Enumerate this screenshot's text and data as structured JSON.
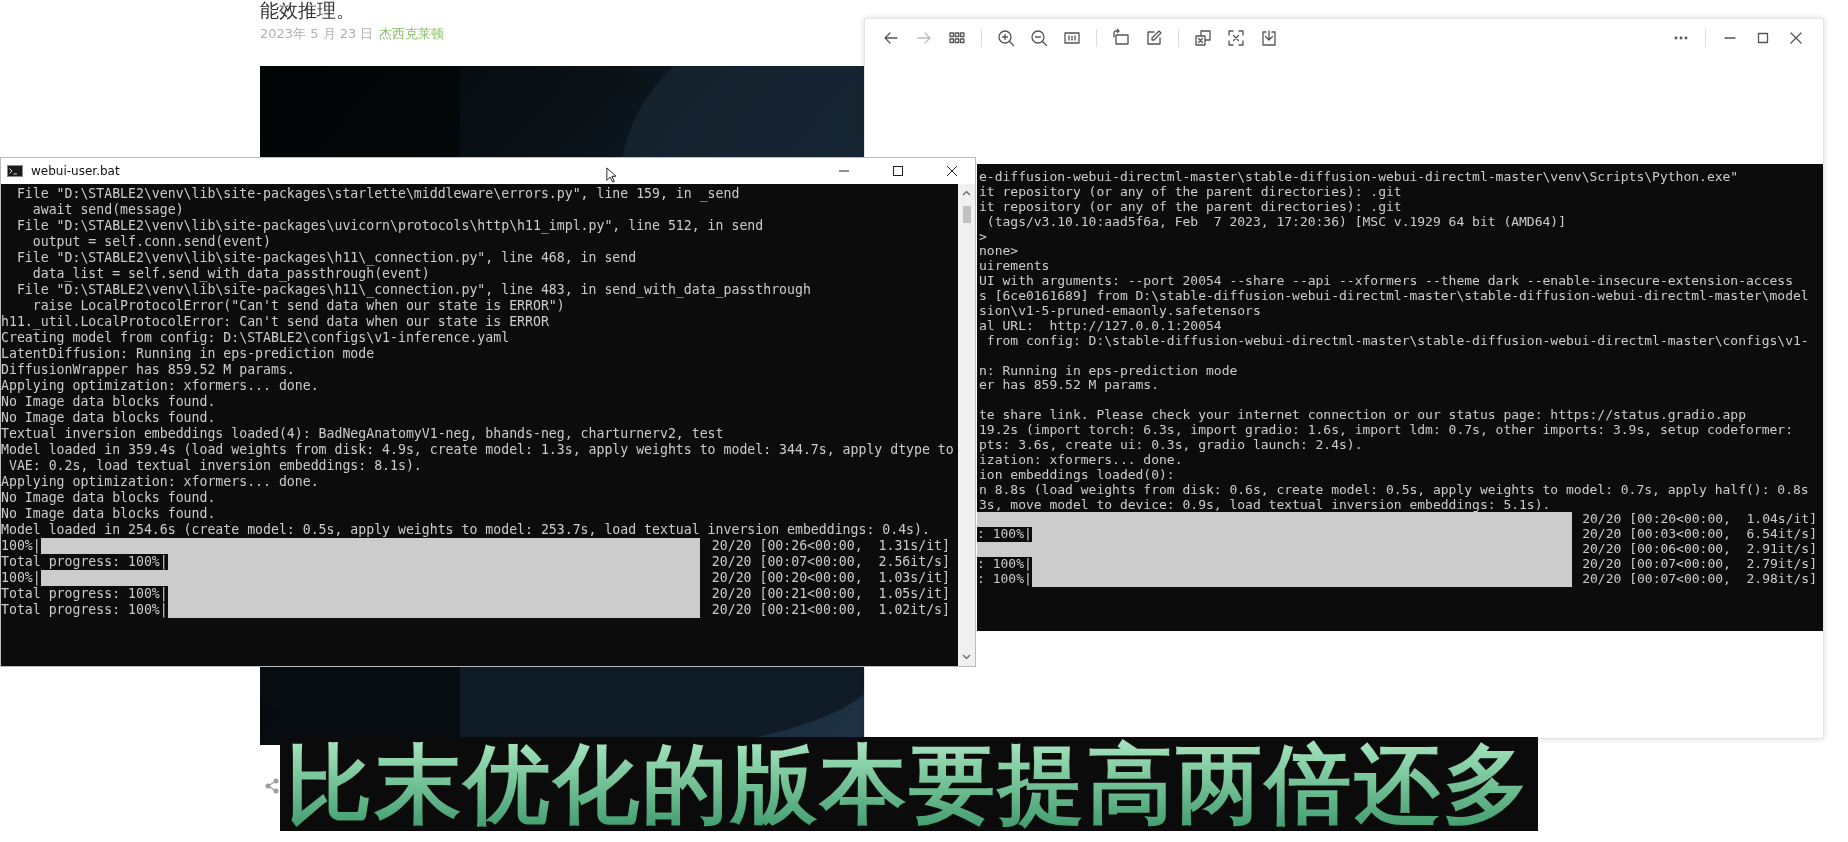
{
  "background_page": {
    "heading": "能效推理。",
    "date": "2023年 5 月 23 日",
    "author": "杰西克莱顿"
  },
  "image_viewer": {
    "terminal_lines": [
      {
        "kind": "text",
        "text": "e-diffusion-webui-directml-master\\stable-diffusion-webui-directml-master\\venv\\Scripts\\Python.exe\""
      },
      {
        "kind": "text",
        "text": "it repository (or any of the parent directories): .git"
      },
      {
        "kind": "text",
        "text": "it repository (or any of the parent directories): .git"
      },
      {
        "kind": "text",
        "text": " (tags/v3.10.10:aad5f6a, Feb  7 2023, 17:20:36) [MSC v.1929 64 bit (AMD64)]"
      },
      {
        "kind": "text",
        "text": ">"
      },
      {
        "kind": "text",
        "text": "none>"
      },
      {
        "kind": "text",
        "text": "uirements"
      },
      {
        "kind": "text",
        "text": "UI with arguments: --port 20054 --share --api --xformers --theme dark --enable-insecure-extension-access"
      },
      {
        "kind": "text",
        "text": "s [6ce0161689] from D:\\stable-diffusion-webui-directml-master\\stable-diffusion-webui-directml-master\\model"
      },
      {
        "kind": "text",
        "text": "sion\\v1-5-pruned-emaonly.safetensors"
      },
      {
        "kind": "text",
        "text": "al URL:  http://127.0.0.1:20054"
      },
      {
        "kind": "text",
        "text": " from config: D:\\stable-diffusion-webui-directml-master\\stable-diffusion-webui-directml-master\\configs\\v1-"
      },
      {
        "kind": "blank"
      },
      {
        "kind": "text",
        "text": "n: Running in eps-prediction mode"
      },
      {
        "kind": "text",
        "text": "er has 859.52 M params."
      },
      {
        "kind": "blank"
      },
      {
        "kind": "text",
        "text": "te share link. Please check your internet connection or our status page: https://status.gradio.app"
      },
      {
        "kind": "text",
        "text": "19.2s (import torch: 6.3s, import gradio: 1.6s, import ldm: 0.7s, other imports: 3.9s, setup codeformer:"
      },
      {
        "kind": "text",
        "text": "pts: 3.6s, create ui: 0.3s, gradio launch: 2.4s)."
      },
      {
        "kind": "text",
        "text": "ization: xformers... done."
      },
      {
        "kind": "text",
        "text": "ion embeddings loaded(0):"
      },
      {
        "kind": "text",
        "text": "n 8.8s (load weights from disk: 0.6s, create model: 0.5s, apply weights to model: 0.7s, apply half(): 0.8s"
      },
      {
        "kind": "text",
        "text": "3s, move model to device: 0.9s, load textual inversion embeddings: 5.1s)."
      },
      {
        "kind": "progress",
        "level": 1,
        "stats": "20/20 [00:20<00:00,  1.04s/it]"
      },
      {
        "kind": "progress",
        "label": ": 100%|",
        "level": 1,
        "stats": "20/20 [00:03<00:00,  6.54it/s]"
      },
      {
        "kind": "progress",
        "level": 1,
        "stats": "20/20 [00:06<00:00,  2.91it/s]"
      },
      {
        "kind": "progress",
        "label": ": 100%|",
        "level": 1,
        "stats": "20/20 [00:07<00:00,  2.79it/s]"
      },
      {
        "kind": "progress",
        "label": ": 100%|",
        "level": 1,
        "stats": "20/20 [00:07<00:00,  2.98it/s]"
      }
    ]
  },
  "console_window": {
    "title": "webui-user.bat",
    "lines": [
      {
        "kind": "text",
        "text": "  File \"D:\\STABLE2\\venv\\lib\\site-packages\\starlette\\middleware\\errors.py\", line 159, in _send"
      },
      {
        "kind": "text",
        "text": "    await send(message)"
      },
      {
        "kind": "text",
        "text": "  File \"D:\\STABLE2\\venv\\lib\\site-packages\\uvicorn\\protocols\\http\\h11_impl.py\", line 512, in send"
      },
      {
        "kind": "text",
        "text": "    output = self.conn.send(event)"
      },
      {
        "kind": "text",
        "text": "  File \"D:\\STABLE2\\venv\\lib\\site-packages\\h11\\_connection.py\", line 468, in send"
      },
      {
        "kind": "text",
        "text": "    data_list = self.send_with_data_passthrough(event)"
      },
      {
        "kind": "text",
        "text": "  File \"D:\\STABLE2\\venv\\lib\\site-packages\\h11\\_connection.py\", line 483, in send_with_data_passthrough"
      },
      {
        "kind": "text",
        "text": "    raise LocalProtocolError(\"Can't send data when our state is ERROR\")"
      },
      {
        "kind": "text",
        "text": "h11._util.LocalProtocolError: Can't send data when our state is ERROR"
      },
      {
        "kind": "text",
        "text": "Creating model from config: D:\\STABLE2\\configs\\v1-inference.yaml"
      },
      {
        "kind": "text",
        "text": "LatentDiffusion: Running in eps-prediction mode"
      },
      {
        "kind": "text",
        "text": "DiffusionWrapper has 859.52 M params."
      },
      {
        "kind": "text",
        "text": "Applying optimization: xformers... done."
      },
      {
        "kind": "text",
        "text": "No Image data blocks found."
      },
      {
        "kind": "text",
        "text": "No Image data blocks found."
      },
      {
        "kind": "text",
        "text": "Textual inversion embeddings loaded(4): BadNegAnatomyV1-neg, bhands-neg, charturnerv2, test"
      },
      {
        "kind": "text",
        "text": "Model loaded in 359.4s (load weights from disk: 4.9s, create model: 1.3s, apply weights to model: 344.7s, apply dtype to"
      },
      {
        "kind": "text",
        "text": " VAE: 0.2s, load textual inversion embeddings: 8.1s)."
      },
      {
        "kind": "text",
        "text": "Applying optimization: xformers... done."
      },
      {
        "kind": "text",
        "text": "No Image data blocks found."
      },
      {
        "kind": "text",
        "text": "No Image data blocks found."
      },
      {
        "kind": "text",
        "text": "Model loaded in 254.6s (create model: 0.5s, apply weights to model: 253.7s, load textual inversion embeddings: 0.4s)."
      },
      {
        "kind": "progress",
        "label": "100%|",
        "level": 1,
        "stats": "20/20 [00:26<00:00,  1.31s/it]"
      },
      {
        "kind": "progress",
        "label": "Total progress: 100%|",
        "level": 1,
        "stats": "20/20 [00:07<00:00,  2.56it/s]"
      },
      {
        "kind": "progress",
        "label": "100%|",
        "level": 1,
        "stats": "20/20 [00:20<00:00,  1.03s/it]"
      },
      {
        "kind": "progress",
        "label": "Total progress: 100%|",
        "level": 1,
        "stats": "20/20 [00:21<00:00,  1.05s/it]"
      },
      {
        "kind": "progress",
        "label": "Total progress: 100%|",
        "level": 1,
        "stats": "20/20 [00:21<00:00,  1.02it/s]"
      }
    ]
  },
  "subtitle": "比末优化的版本要提高两倍还多"
}
